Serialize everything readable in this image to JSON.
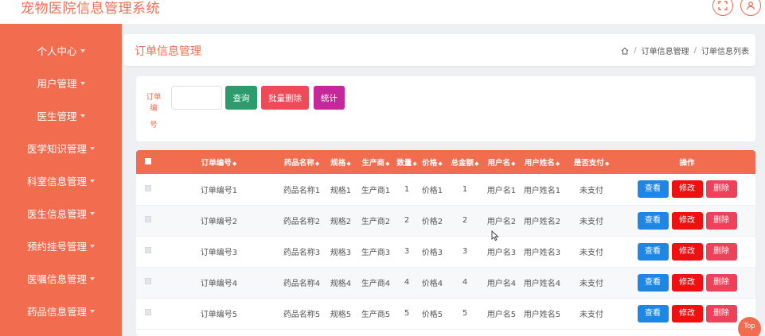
{
  "app": {
    "title": "宠物医院信息管理系统",
    "accent_color": "#f26c4f",
    "icons": [
      "fullscreen-icon",
      "user-icon"
    ]
  },
  "sidebar": {
    "items": [
      {
        "label": "个人中心"
      },
      {
        "label": "用户管理"
      },
      {
        "label": "医生管理"
      },
      {
        "label": "医学知识管理"
      },
      {
        "label": "科室信息管理"
      },
      {
        "label": "医生信息管理"
      },
      {
        "label": "预约挂号管理"
      },
      {
        "label": "医嘱信息管理"
      },
      {
        "label": "药品信息管理"
      }
    ]
  },
  "header": {
    "title": "订单信息管理",
    "breadcrumb": [
      "订单信息管理",
      "订单信息列表"
    ],
    "breadcrumb_sep": "/"
  },
  "search": {
    "label_line1": "订单编",
    "label_line2": "号",
    "value": "",
    "query_label": "查询",
    "batch_delete_label": "批量删除",
    "stats_label": "统计"
  },
  "table": {
    "sort_mark": "◆",
    "columns": [
      "订单编号",
      "药品名称",
      "规格",
      "生产商",
      "数量",
      "价格",
      "总金额",
      "用户名",
      "用户姓名",
      "是否支付",
      "操作"
    ],
    "rows": [
      [
        "订单编号1",
        "药品名称1",
        "规格1",
        "生产商1",
        "1",
        "价格1",
        "1",
        "用户名1",
        "用户姓名1",
        "未支付"
      ],
      [
        "订单编号2",
        "药品名称2",
        "规格2",
        "生产商2",
        "2",
        "价格2",
        "2",
        "用户名2",
        "用户姓名2",
        "未支付"
      ],
      [
        "订单编号3",
        "药品名称3",
        "规格3",
        "生产商3",
        "3",
        "价格3",
        "3",
        "用户名3",
        "用户姓名3",
        "未支付"
      ],
      [
        "订单编号4",
        "药品名称4",
        "规格4",
        "生产商4",
        "4",
        "价格4",
        "4",
        "用户名4",
        "用户姓名4",
        "未支付"
      ],
      [
        "订单编号5",
        "药品名称5",
        "规格5",
        "生产商5",
        "5",
        "价格5",
        "5",
        "用户名5",
        "用户姓名5",
        "未支付"
      ]
    ],
    "actions": {
      "view": "查看",
      "edit": "修改",
      "delete": "删除"
    }
  },
  "back_to_top": "Top"
}
